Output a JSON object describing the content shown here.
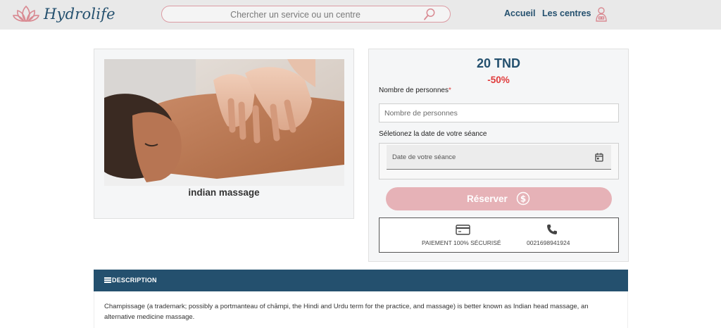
{
  "header": {
    "brand": "Hydrolife",
    "search_placeholder": "Chercher un service ou un centre",
    "nav": {
      "home": "Accueil",
      "centers": "Les centres"
    }
  },
  "product": {
    "title": "indian massage",
    "image": "massage-photo"
  },
  "booking": {
    "price": "20 TND",
    "discount": "-50%",
    "persons_label": "Nombre de personnes",
    "required_mark": "*",
    "persons_placeholder": "Nombre de personnes",
    "date_label": "Séletionez la date de votre séance",
    "date_placeholder": "Date de votre séance",
    "reserve_label": "Réserver",
    "secure_payment": "PAIEMENT 100% SÉCURISÉ",
    "phone": "0021698941924"
  },
  "description": {
    "title": "DESCRIPTION",
    "text": "Champissage (a trademark; possibly a portmanteau of chāmpi, the Hindi and Urdu term for the practice, and massage) is better known as Indian head massage, an alternative medicine massage."
  },
  "colors": {
    "primary": "#24506e",
    "accent_pink": "#e6b2b7",
    "discount_red": "#e03a3a",
    "header_bg": "#e9e9e9"
  },
  "icons": [
    "lotus-logo-icon",
    "search-icon",
    "user-icon",
    "calendar-icon",
    "dollar-icon",
    "credit-card-icon",
    "phone-icon",
    "list-icon"
  ]
}
